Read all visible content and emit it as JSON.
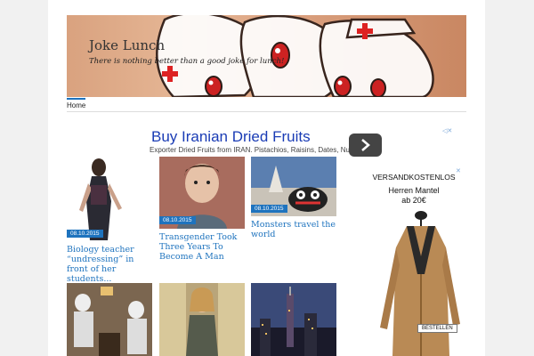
{
  "site": {
    "title": "Joke Lunch",
    "tagline": "There is nothing better than a good joke for lunch!"
  },
  "nav": {
    "items": [
      {
        "label": "Home"
      }
    ]
  },
  "ad": {
    "title": "Buy Iranian Dried Fruits",
    "subtitle": "Exporter Dried Fruits from IRAN. Pistachios, Raisins, Dates, Nuts"
  },
  "posts": [
    {
      "date": "08.10.2015",
      "caption": "Biology teacher “undressing” in front of her students..."
    },
    {
      "date": "08.10.2015",
      "caption": "Transgender Took Three Years To Become A Man"
    },
    {
      "date": "08.10.2015",
      "caption": "Monsters travel the world"
    }
  ],
  "side_ad": {
    "headline": "VERSANDKOSTENLOS",
    "product": "Herren Mantel",
    "price": "ab 20€",
    "button": "BESTELLEN"
  },
  "colors": {
    "accent": "#1e73be",
    "ad_link": "#1a3cb5"
  }
}
